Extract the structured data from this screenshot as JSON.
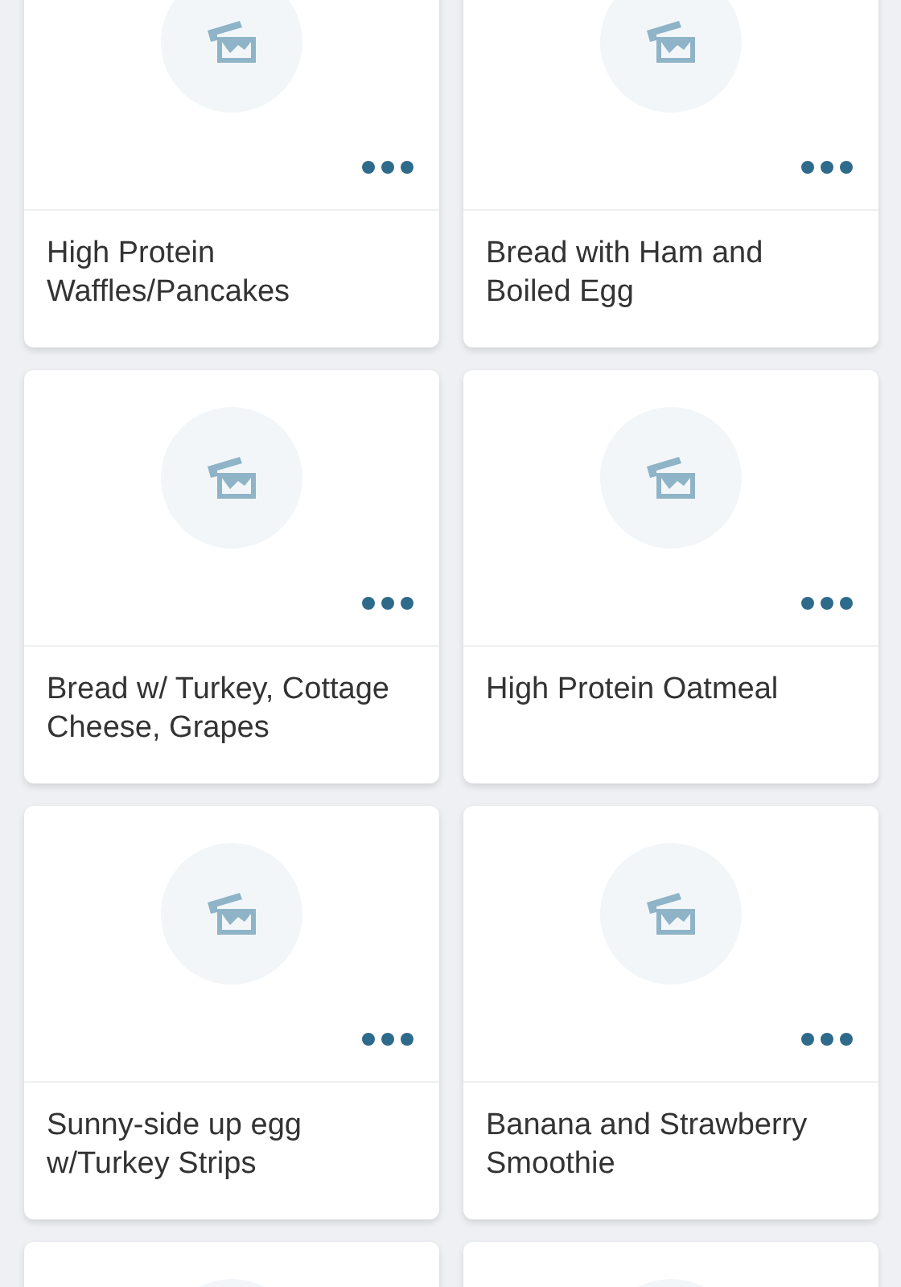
{
  "cards": [
    {
      "kind": "recipe",
      "title": "High Protein Waffles/Pancakes"
    },
    {
      "kind": "recipe",
      "title": "Bread with Ham and Boiled Egg"
    },
    {
      "kind": "recipe",
      "title": "Bread w/ Turkey, Cottage Cheese, Grapes"
    },
    {
      "kind": "recipe",
      "title": "High Protein Oatmeal"
    },
    {
      "kind": "recipe",
      "title": "Sunny-side up egg w/Turkey Strips"
    },
    {
      "kind": "recipe",
      "title": "Banana and Strawberry Smoothie"
    },
    {
      "kind": "cut-off"
    },
    {
      "kind": "cut-off"
    }
  ]
}
